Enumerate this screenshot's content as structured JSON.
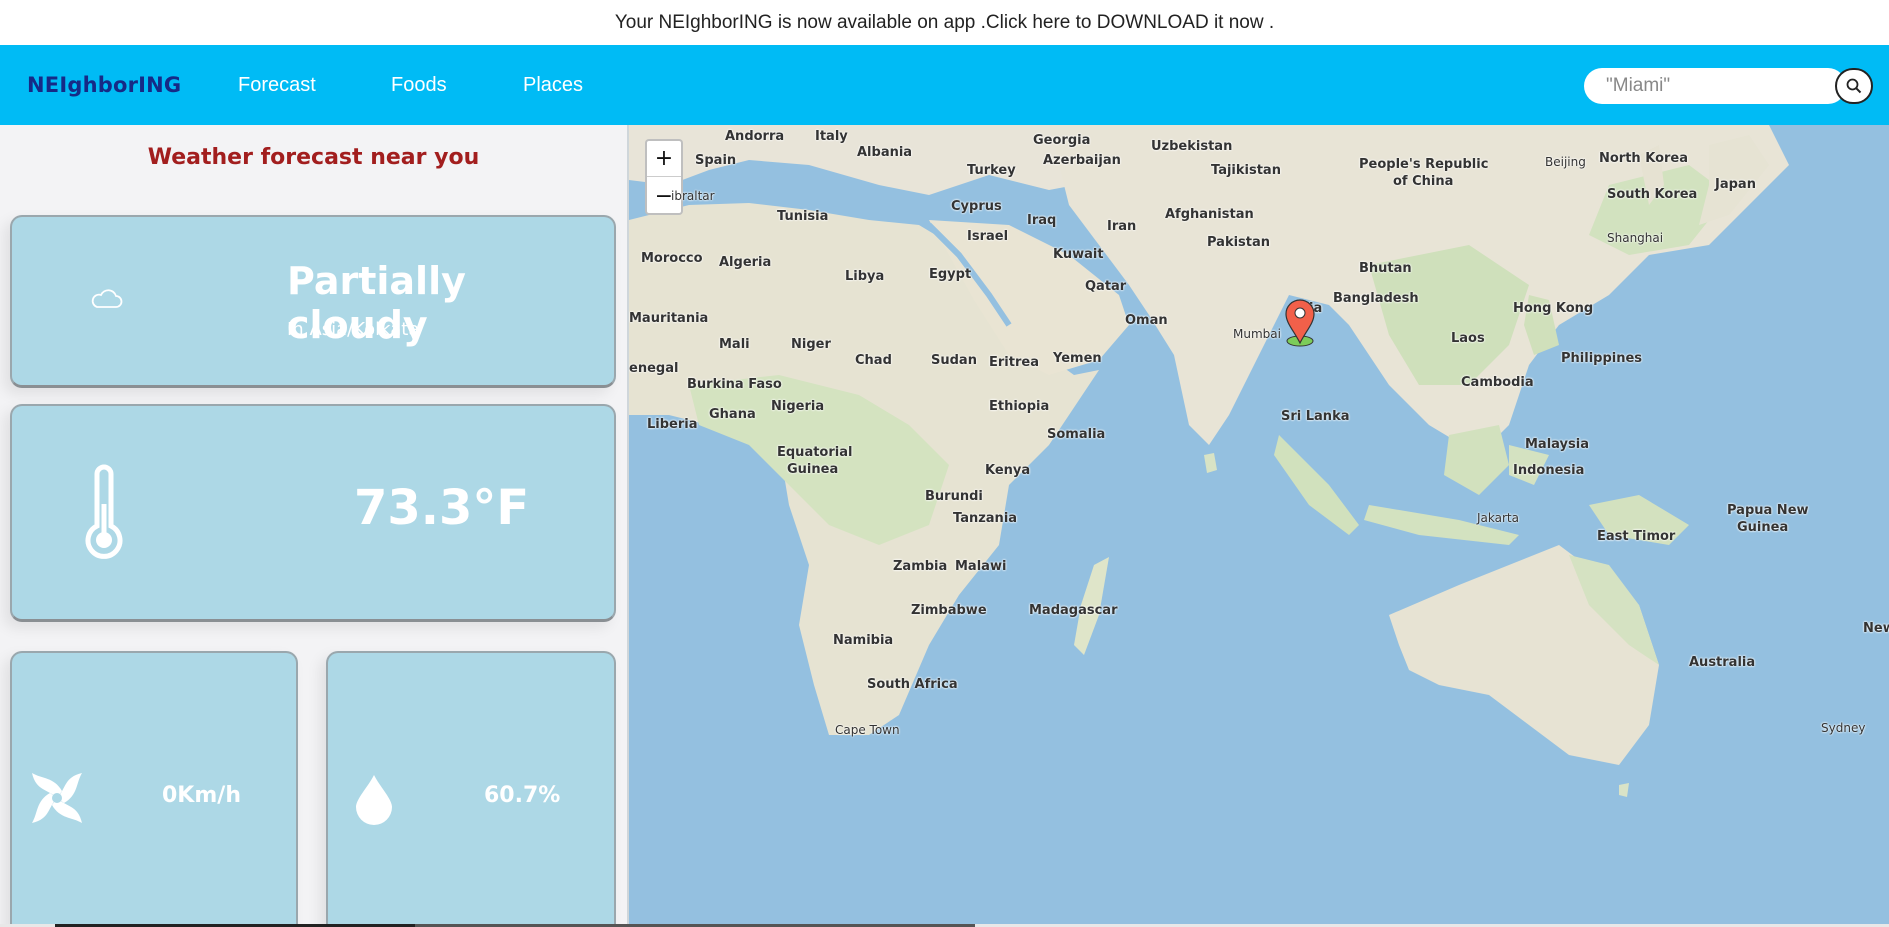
{
  "banner": {
    "text": "Your NEIghborING is now available on app .Click here to DOWNLOAD it now ."
  },
  "navbar": {
    "brand": "NEIghborING",
    "links": [
      "Forecast",
      "Foods",
      "Places"
    ],
    "search_placeholder": "\"Miami\"",
    "search_icon": "search-icon",
    "bg_color": "#00bbf5"
  },
  "weather": {
    "title": "Weather forecast near you",
    "condition": "Partially cloudy",
    "timezone": "In Asia/Kolkata",
    "temperature": "73.3°F",
    "wind": "0Km/h",
    "humidity": "60.7%",
    "icons": [
      "cloud-icon",
      "thermometer-icon",
      "wind-icon",
      "water-drop-icon"
    ],
    "card_color": "#add8e6",
    "title_color": "#a21e1e"
  },
  "map": {
    "zoom_in": "+",
    "zoom_out": "−",
    "labels": {
      "andorra": "Andorra",
      "italy": "Italy",
      "spain": "Spain",
      "albania": "Albania",
      "gibraltar": "ibraltar",
      "tunisia": "Tunisia",
      "morocco": "Morocco",
      "algeria": "Algeria",
      "libya": "Libya",
      "egypt": "Egypt",
      "mauritania": "Mauritania",
      "mali": "Mali",
      "niger": "Niger",
      "chad": "Chad",
      "sudan": "Sudan",
      "eritrea": "Eritrea",
      "senegal": "enegal",
      "burkina": "Burkina Faso",
      "ghana": "Ghana",
      "nigeria": "Nigeria",
      "liberia": "Liberia",
      "ethiopia": "Ethiopia",
      "somalia": "Somalia",
      "eqguinea_1": "Equatorial",
      "eqguinea_2": "Guinea",
      "kenya": "Kenya",
      "burundi": "Burundi",
      "tanzania": "Tanzania",
      "zambia": "Zambia",
      "malawi": "Malawi",
      "zimbabwe": "Zimbabwe",
      "madagascar": "Madagascar",
      "namibia": "Namibia",
      "southafrica": "South Africa",
      "capetown": "Cape Town",
      "georgia": "Georgia",
      "azerbaijan": "Azerbaijan",
      "turkey": "Turkey",
      "cyprus": "Cyprus",
      "iraq": "Iraq",
      "iran": "Iran",
      "israel": "Israel",
      "kuwait": "Kuwait",
      "qatar": "Qatar",
      "oman": "Oman",
      "yemen": "Yemen",
      "uzbekistan": "Uzbekistan",
      "tajikistan": "Tajikistan",
      "afghanistan": "Afghanistan",
      "pakistan": "Pakistan",
      "mumbai": "Mumbai",
      "india": "ia",
      "srilanka": "Sri Lanka",
      "bhutan": "Bhutan",
      "bangladesh": "Bangladesh",
      "prc_1": "People's Republic",
      "prc_2": "of China",
      "beijing": "Beijing",
      "northkorea": "North Korea",
      "southkorea": "South Korea",
      "japan": "Japan",
      "shanghai": "Shanghai",
      "hongkong": "Hong Kong",
      "laos": "Laos",
      "philippines": "Philippines",
      "cambodia": "Cambodia",
      "malaysia": "Malaysia",
      "indonesia": "Indonesia",
      "jakarta": "Jakarta",
      "easttimor": "East Timor",
      "png_1": "Papua New",
      "png_2": "Guinea",
      "australia": "Australia",
      "sydney": "Sydney",
      "newz": "New"
    },
    "marker_icon": "map-pin-icon",
    "water_color": "#94c0e0",
    "land_color": "#e8e4d8"
  }
}
